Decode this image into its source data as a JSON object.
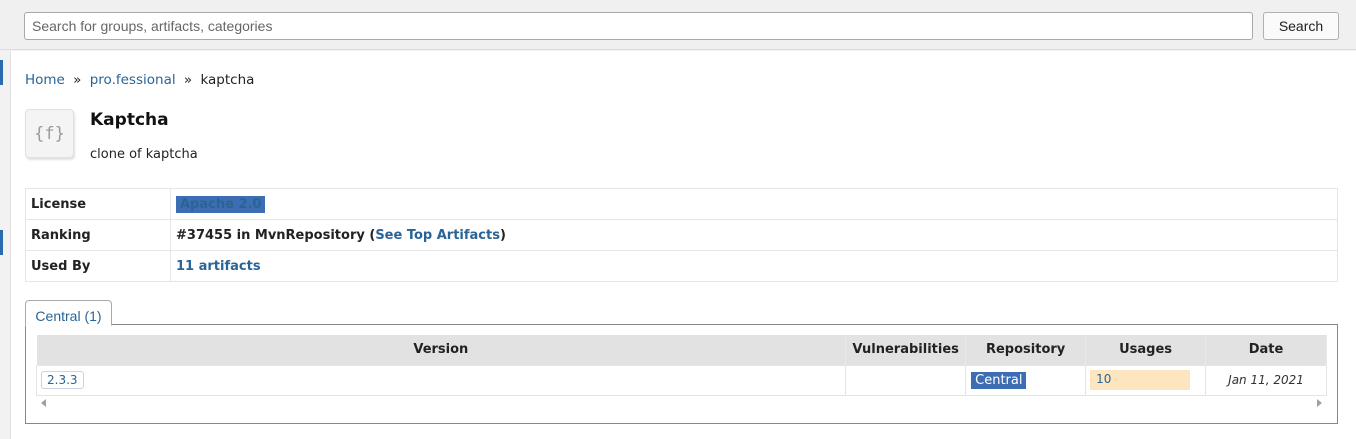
{
  "search": {
    "placeholder": "Search for groups, artifacts, categories",
    "button": "Search"
  },
  "breadcrumb": {
    "home": "Home",
    "sep1": "»",
    "group": "pro.fessional",
    "sep2": "»",
    "current": "kaptcha"
  },
  "artifact": {
    "logo_text": "{f}",
    "title": "Kaptcha",
    "description": "clone of kaptcha"
  },
  "info": {
    "license": {
      "label": "License",
      "value": "Apache 2.0"
    },
    "ranking": {
      "label": "Ranking",
      "prefix": "#37455 in MvnRepository (",
      "link": "See Top Artifacts",
      "suffix": ")"
    },
    "used_by": {
      "label": "Used By",
      "value": "11 artifacts"
    }
  },
  "tabs": [
    {
      "label": "Central (1)"
    }
  ],
  "versions": {
    "headers": [
      "Version",
      "Vulnerabilities",
      "Repository",
      "Usages",
      "Date"
    ],
    "rows": [
      {
        "version": "2.3.3",
        "vulnerabilities": "",
        "repository": "Central",
        "usages": "10",
        "date": "Jan 11, 2021"
      }
    ]
  },
  "colors": {
    "link": "#2a6496",
    "badge": "#3d6eb4",
    "usage_bg": "#fde6bf"
  },
  "icons": {
    "logo": "artifact-placeholder-icon",
    "scroll_left": "triangle-left-icon",
    "scroll_right": "triangle-right-icon"
  }
}
